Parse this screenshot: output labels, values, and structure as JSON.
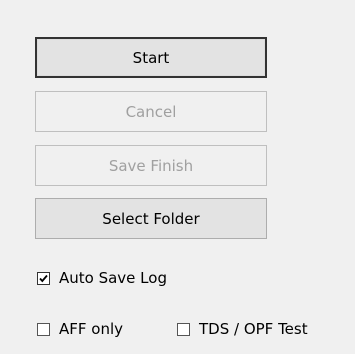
{
  "buttons": {
    "start": "Start",
    "cancel": "Cancel",
    "save_finish": "Save Finish",
    "select_folder": "Select Folder"
  },
  "checkboxes": {
    "auto_save_log": {
      "label": "Auto Save Log",
      "checked": true
    },
    "aff_only": {
      "label": "AFF only",
      "checked": false
    },
    "tds_opf_test": {
      "label": "TDS / OPF Test",
      "checked": false
    }
  }
}
